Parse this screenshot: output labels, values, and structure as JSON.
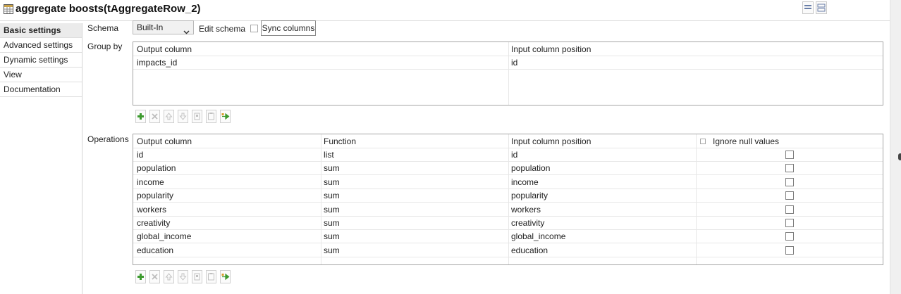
{
  "header": {
    "title": "aggregate boosts(tAggregateRow_2)",
    "title_icon": "aggregate-component-icon"
  },
  "sidebar": {
    "items": [
      {
        "label": "Basic settings",
        "active": true
      },
      {
        "label": "Advanced settings",
        "active": false
      },
      {
        "label": "Dynamic settings",
        "active": false
      },
      {
        "label": "View",
        "active": false
      },
      {
        "label": "Documentation",
        "active": false
      }
    ]
  },
  "schema": {
    "label": "Schema",
    "value": "Built-In",
    "edit_label": "Edit schema",
    "sync_label": "Sync columns"
  },
  "group_by": {
    "label": "Group by",
    "columns": [
      "Output column",
      "Input column position"
    ],
    "rows": [
      [
        "impacts_id",
        "id"
      ]
    ]
  },
  "operations": {
    "label": "Operations",
    "columns": [
      "Output column",
      "Function",
      "Input column position",
      "Ignore null values"
    ],
    "rows": [
      [
        "id",
        "list",
        "id"
      ],
      [
        "population",
        "sum",
        "population"
      ],
      [
        "income",
        "sum",
        "income"
      ],
      [
        "popularity",
        "sum",
        "popularity"
      ],
      [
        "workers",
        "sum",
        "workers"
      ],
      [
        "creativity",
        "sum",
        "creativity"
      ],
      [
        "global_income",
        "sum",
        "global_income"
      ],
      [
        "education",
        "sum",
        "education"
      ]
    ]
  },
  "toolbar_icons": [
    "add-icon",
    "remove-icon",
    "move-up-icon",
    "move-down-icon",
    "copy-icon",
    "paste-icon",
    "import-icon"
  ],
  "colors": {
    "add_green": "#3c9a2e",
    "active_tab_bg": "#ebebeb"
  }
}
